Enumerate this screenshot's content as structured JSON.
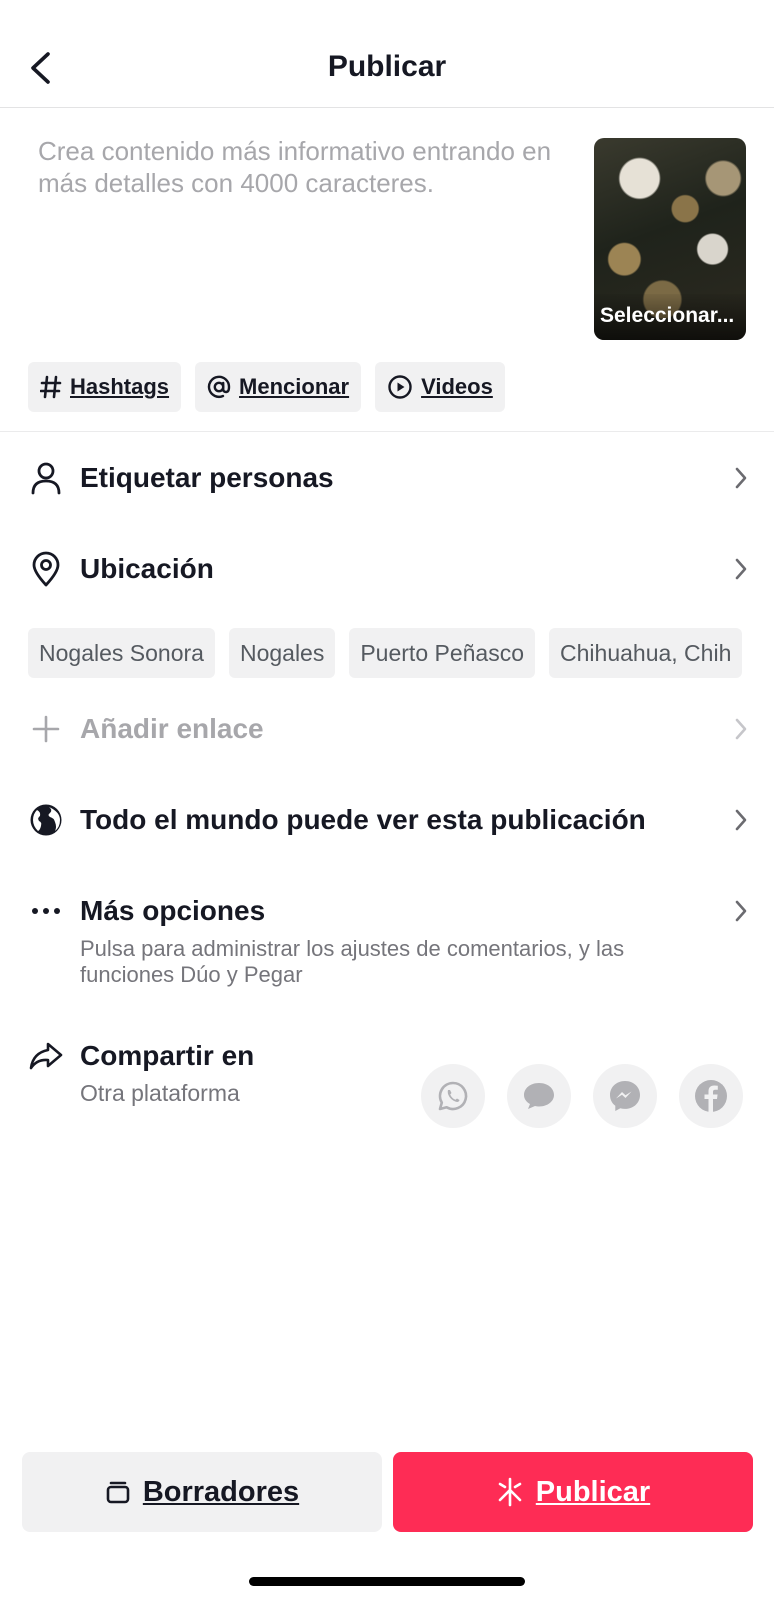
{
  "header": {
    "title": "Publicar"
  },
  "description": {
    "placeholder": "Crea contenido más informativo entrando en más detalles con 4000 caracteres."
  },
  "cover": {
    "label": "Seleccionar..."
  },
  "chips": [
    {
      "icon": "hash-icon",
      "label": "Hashtags"
    },
    {
      "icon": "at-icon",
      "label": "Mencionar"
    },
    {
      "icon": "play-circle-icon",
      "label": "Videos"
    }
  ],
  "rows": {
    "tag_people": {
      "label": "Etiquetar personas"
    },
    "location": {
      "label": "Ubicación"
    },
    "add_link": {
      "label": "Añadir enlace"
    },
    "privacy": {
      "label": "Todo el mundo puede ver esta publicación"
    },
    "more_options": {
      "label": "Más opciones",
      "subtext": "Pulsa para administrar los ajustes de comentarios, y las funciones Dúo y Pegar"
    },
    "share": {
      "label": "Compartir en",
      "subtext": "Otra plataforma"
    }
  },
  "location_suggestions": [
    "Nogales Sonora",
    "Nogales",
    "Puerto Peñasco",
    "Chihuahua, Chih"
  ],
  "share_targets": [
    "whatsapp-icon",
    "message-icon",
    "messenger-icon",
    "facebook-icon"
  ],
  "bottom": {
    "drafts_label": "Borradores",
    "publish_label": "Publicar"
  },
  "colors": {
    "accent": "#fe2c55",
    "text": "#161823",
    "muted": "#a7a7ab",
    "chip_bg": "#f1f1f2"
  }
}
